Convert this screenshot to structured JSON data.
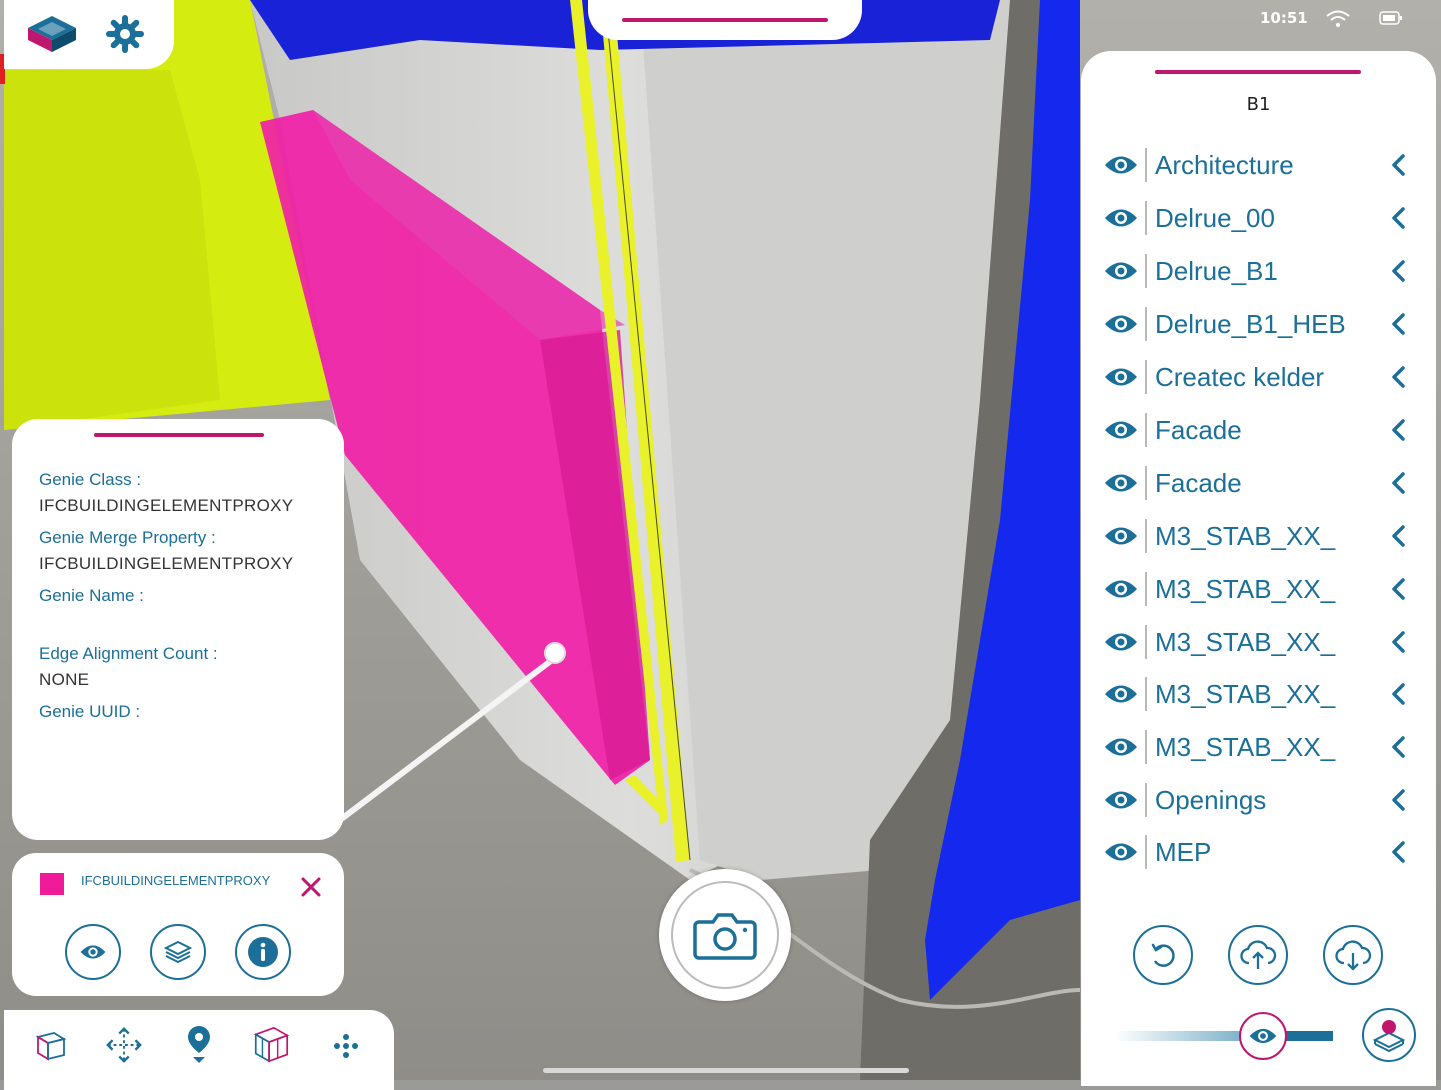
{
  "status_bar": {
    "time": "10:51"
  },
  "layers": {
    "title": "B1",
    "items": [
      {
        "label": "Architecture"
      },
      {
        "label": "Delrue_00"
      },
      {
        "label": "Delrue_B1"
      },
      {
        "label": "Delrue_B1_HEB"
      },
      {
        "label": "Createc kelder"
      },
      {
        "label": "Facade"
      },
      {
        "label": "Facade"
      },
      {
        "label": "M3_STAB_XX_"
      },
      {
        "label": "M3_STAB_XX_"
      },
      {
        "label": "M3_STAB_XX_"
      },
      {
        "label": "M3_STAB_XX_"
      },
      {
        "label": "M3_STAB_XX_"
      },
      {
        "label": "Openings"
      },
      {
        "label": "MEP"
      }
    ]
  },
  "properties": {
    "genie_class_label": "Genie Class :",
    "genie_class_value": "IFCBUILDINGELEMENTPROXY",
    "merge_property_label": "Genie Merge Property :",
    "merge_property_value": "IFCBUILDINGELEMENTPROXY",
    "genie_name_label": "Genie Name :",
    "edge_count_label": "Edge Alignment Count :",
    "edge_count_value": "NONE",
    "uuid_label": "Genie UUID :"
  },
  "selection": {
    "label": "IFCBUILDINGELEMENTPROXY",
    "swatch_color": "#ef1b98"
  },
  "colors": {
    "accent": "#c0176e",
    "primary": "#1b6f98"
  },
  "icons": {
    "top_left": [
      "model-icon",
      "gear-icon"
    ],
    "toolbar": [
      "cube-view-icon",
      "move-icon",
      "location-pin-icon",
      "section-box-icon",
      "dots-icon"
    ],
    "selection_actions": [
      "eye-icon",
      "layers-icon",
      "info-icon"
    ],
    "layer_actions": [
      "undo-icon",
      "cloud-upload-icon",
      "cloud-download-icon"
    ]
  }
}
